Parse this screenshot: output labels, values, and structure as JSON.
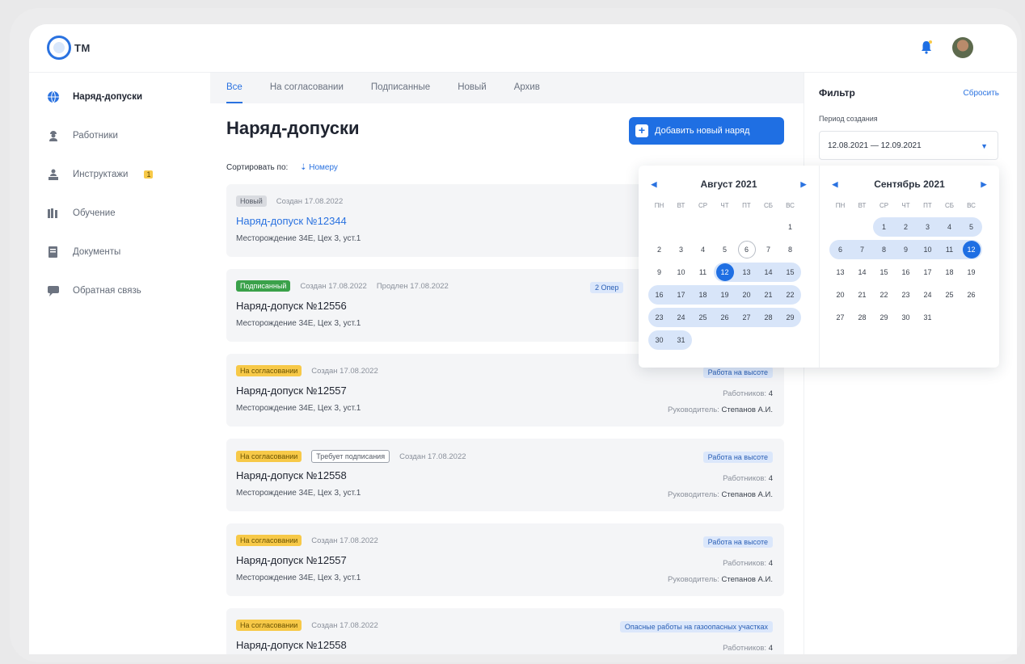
{
  "app": {
    "logo_text": "ТМ"
  },
  "sidebar": {
    "items": [
      {
        "label": "Наряд-допуски",
        "icon": "globe-icon"
      },
      {
        "label": "Работники",
        "icon": "worker-icon"
      },
      {
        "label": "Инструктажи",
        "icon": "people-icon",
        "badge": "1"
      },
      {
        "label": "Обучение",
        "icon": "books-icon"
      },
      {
        "label": "Документы",
        "icon": "document-icon"
      },
      {
        "label": "Обратная связь",
        "icon": "feedback-icon"
      }
    ]
  },
  "tabs": [
    "Все",
    "На согласовании",
    "Подписанные",
    "Новый",
    "Архив"
  ],
  "main": {
    "title": "Наряд-допуски",
    "add_button": "Добавить новый наряд",
    "sort_label": "Сортировать по:",
    "sort_value": "Номеру"
  },
  "cards": [
    {
      "status": "Новый",
      "status_type": "new",
      "created": "Создан 17.08.2022",
      "title": "Наряд-допуск №12344",
      "place": "Месторождение 34Е, Цех 3, уст.1"
    },
    {
      "status": "Подписанный",
      "status_type": "signed",
      "created": "Создан 17.08.2022",
      "extra": "Продлен 17.08.2022",
      "title": "Наряд-допуск №12556",
      "place": "Месторождение 34Е, Цех 3, уст.1",
      "tag": "2 Опер"
    },
    {
      "status": "На согласовании",
      "status_type": "approve",
      "created": "Создан 17.08.2022",
      "title": "Наряд-допуск №12557",
      "place": "Месторождение 34Е, Цех 3, уст.1",
      "tag": "Работа на высоте",
      "workers_label": "Работников:",
      "workers": "4",
      "lead_label": "Руководитель:",
      "lead": "Степанов А.И."
    },
    {
      "status": "На согласовании",
      "status_type": "approve",
      "status2": "Требует подписания",
      "created": "Создан 17.08.2022",
      "title": "Наряд-допуск №12558",
      "place": "Месторождение 34Е, Цех 3, уст.1",
      "tag": "Работа на высоте",
      "workers_label": "Работников:",
      "workers": "4",
      "lead_label": "Руководитель:",
      "lead": "Степанов А.И."
    },
    {
      "status": "На согласовании",
      "status_type": "approve",
      "created": "Создан 17.08.2022",
      "title": "Наряд-допуск №12557",
      "place": "Месторождение 34Е, Цех 3, уст.1",
      "tag": "Работа на высоте",
      "workers_label": "Работников:",
      "workers": "4",
      "lead_label": "Руководитель:",
      "lead": "Степанов А.И."
    },
    {
      "status": "На согласовании",
      "status_type": "approve",
      "created": "Создан 17.08.2022",
      "title": "Наряд-допуск №12558",
      "place": "",
      "tag": "Опасные работы на газоопасных участках",
      "workers_label": "Работников:",
      "workers": "4"
    }
  ],
  "filter": {
    "title": "Фильтр",
    "reset": "Сбросить",
    "period_label": "Период создания",
    "period_value": "12.08.2021 — 12.09.2021"
  },
  "calendar": {
    "weekdays": [
      "ПН",
      "ВТ",
      "СР",
      "ЧТ",
      "ПТ",
      "СБ",
      "ВС"
    ],
    "months": [
      {
        "title": "Август 2021",
        "offset": 6,
        "days": 31,
        "today": 6,
        "range_from": 12,
        "range_to": 31,
        "selected": 12
      },
      {
        "title": "Сентябрь 2021",
        "offset": 2,
        "days": 31,
        "range_from": 1,
        "range_to": 12,
        "selected": 12
      }
    ]
  },
  "colors": {
    "accent": "#1f6fe3",
    "range": "#d8e5f9"
  }
}
